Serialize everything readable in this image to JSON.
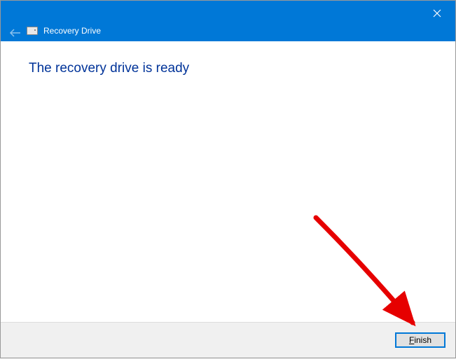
{
  "window": {
    "title": "Recovery Drive"
  },
  "main": {
    "heading": "The recovery drive is ready"
  },
  "footer": {
    "finish_label": "Finish",
    "finish_mnemonic": "F",
    "finish_rest": "inish"
  },
  "icons": {
    "close": "close-icon",
    "back": "back-arrow-icon",
    "drive": "drive-icon"
  },
  "annotation": {
    "arrow_color": "#e60000"
  }
}
